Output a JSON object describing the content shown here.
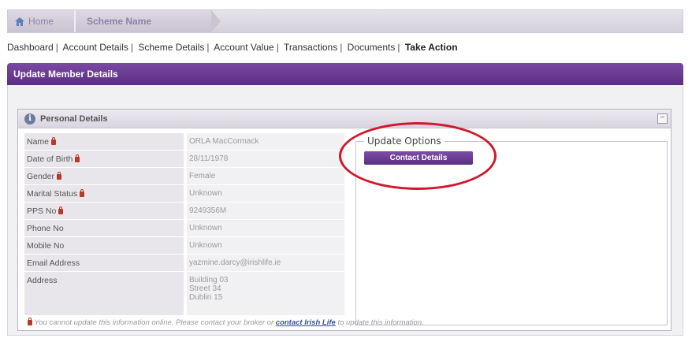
{
  "breadcrumb": {
    "home": "Home",
    "scheme": "Scheme Name"
  },
  "nav": [
    "Dashboard",
    "Account Details",
    "Scheme Details",
    "Account Value",
    "Transactions",
    "Documents",
    "Take Action"
  ],
  "nav_separator": "|",
  "section_title": "Update Member Details",
  "panel": {
    "title": "Personal Details",
    "collapse": "−",
    "rows": [
      {
        "label": "Name",
        "locked": true,
        "value": "ORLA MacCormack"
      },
      {
        "label": "Date of Birth",
        "locked": true,
        "value": "28/11/1978"
      },
      {
        "label": "Gender",
        "locked": true,
        "value": "Female"
      },
      {
        "label": "Marital Status",
        "locked": true,
        "value": "Unknown"
      },
      {
        "label": "PPS No",
        "locked": true,
        "value": "9249356M"
      },
      {
        "label": "Phone No",
        "locked": false,
        "value": "Unknown"
      },
      {
        "label": "Mobile No",
        "locked": false,
        "value": "Unknown"
      },
      {
        "label": "Email Address",
        "locked": false,
        "value": "yazmine.darcy@irishlife.ie"
      }
    ],
    "address": {
      "label": "Address",
      "lines": [
        "Building 03",
        "Street 34",
        "Dublin 15"
      ]
    }
  },
  "update_options": {
    "legend": "Update Options",
    "contact_button": "Contact Details"
  },
  "footnote": {
    "text": "You cannot update this information online. Please contact your broker or",
    "link": "contact Irish Life",
    "suffix": "to update this information."
  },
  "colors": {
    "brand_purple": "#5a2d82",
    "highlight_red": "#d1182f",
    "lock_red": "#b43a2a"
  }
}
